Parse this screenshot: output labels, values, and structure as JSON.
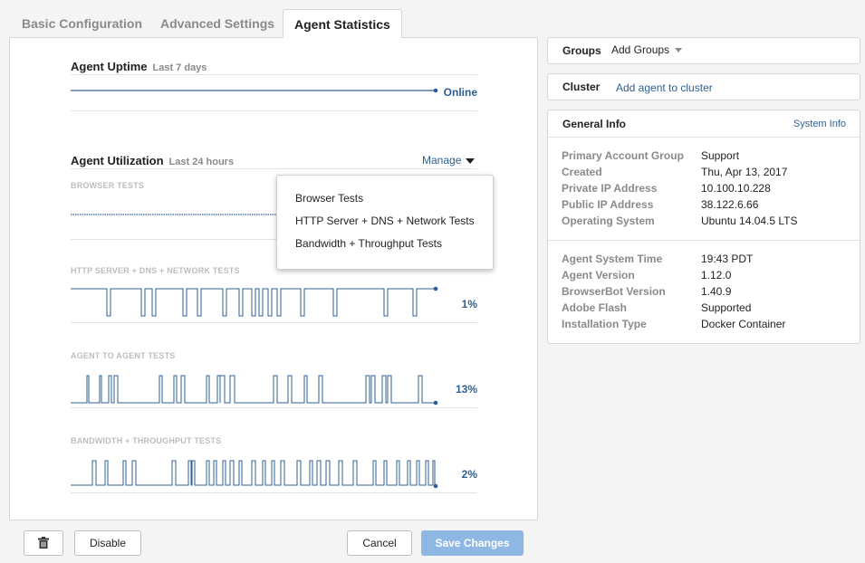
{
  "tabs": [
    {
      "label": "Basic Configuration"
    },
    {
      "label": "Advanced Settings"
    },
    {
      "label": "Agent Statistics",
      "active": true
    }
  ],
  "uptime": {
    "title": "Agent Uptime",
    "subtitle": "Last 7 days",
    "status": "Online"
  },
  "utilization": {
    "title": "Agent Utilization",
    "subtitle": "Last 24 hours",
    "manage_label": "Manage",
    "rows": [
      {
        "label": "BROWSER TESTS",
        "value": ""
      },
      {
        "label": "HTTP SERVER + DNS + NETWORK TESTS",
        "value": "1%"
      },
      {
        "label": "AGENT TO AGENT TESTS",
        "value": "13%"
      },
      {
        "label": "BANDWIDTH + THROUGHPUT TESTS",
        "value": "2%"
      }
    ]
  },
  "manage_menu": {
    "items": [
      {
        "label": "Browser Tests"
      },
      {
        "label": "HTTP Server + DNS + Network Tests"
      },
      {
        "label": "Bandwidth + Throughput Tests"
      }
    ]
  },
  "groups": {
    "label": "Groups",
    "value": "Add Groups"
  },
  "cluster": {
    "label": "Cluster",
    "link": "Add agent to cluster"
  },
  "general_info": {
    "title": "General Info",
    "link": "System Info",
    "section1": [
      {
        "key": "Primary Account Group",
        "value": "Support"
      },
      {
        "key": "Created",
        "value": "Thu, Apr 13, 2017"
      },
      {
        "key": "Private IP Address",
        "value": "10.100.10.228"
      },
      {
        "key": "Public IP Address",
        "value": "38.122.6.66"
      },
      {
        "key": "Operating System",
        "value": "Ubuntu 14.04.5 LTS"
      }
    ],
    "section2": [
      {
        "key": "Agent System Time",
        "value": "19:43 PDT"
      },
      {
        "key": "Agent Version",
        "value": "1.12.0"
      },
      {
        "key": "BrowserBot Version",
        "value": "1.40.9"
      },
      {
        "key": "Adobe Flash",
        "value": "Supported"
      },
      {
        "key": "Installation Type",
        "value": "Docker Container"
      }
    ]
  },
  "footer": {
    "disable_label": "Disable",
    "cancel_label": "Cancel",
    "save_label": "Save Changes"
  },
  "colors": {
    "accent": "#2d5f92",
    "primary_button": "#8fb7e3"
  },
  "icons": {
    "delete": "trash-icon"
  }
}
